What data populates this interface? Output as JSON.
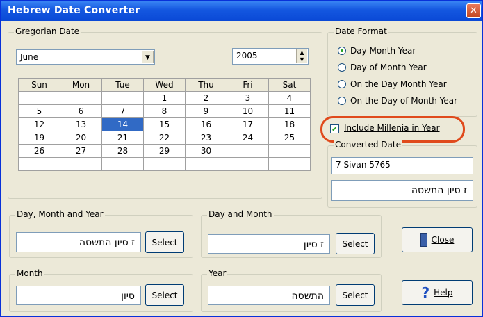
{
  "window": {
    "title": "Hebrew Date Converter",
    "close_glyph": "✕"
  },
  "gregorian": {
    "legend": "Gregorian Date",
    "month": "June",
    "year": "2005",
    "weekdays": [
      "Sun",
      "Mon",
      "Tue",
      "Wed",
      "Thu",
      "Fri",
      "Sat"
    ],
    "weeks": [
      [
        "",
        "",
        "",
        "1",
        "2",
        "3",
        "4"
      ],
      [
        "5",
        "6",
        "7",
        "8",
        "9",
        "10",
        "11"
      ],
      [
        "12",
        "13",
        "14",
        "15",
        "16",
        "17",
        "18"
      ],
      [
        "19",
        "20",
        "21",
        "22",
        "23",
        "24",
        "25"
      ],
      [
        "26",
        "27",
        "28",
        "29",
        "30",
        "",
        ""
      ],
      [
        "",
        "",
        "",
        "",
        "",
        "",
        ""
      ]
    ],
    "selected_day": "14"
  },
  "date_format": {
    "legend": "Date Format",
    "options": [
      "Day Month Year",
      "Day of Month Year",
      "On the Day Month Year",
      "On the Day of Month Year"
    ],
    "selected_index": 0
  },
  "millenia": {
    "label": "Include Millenia in Year",
    "checked": true
  },
  "converted": {
    "legend": "Converted Date",
    "english": "7 Sivan 5765",
    "hebrew": "ז סיון התשסה"
  },
  "groups": {
    "day_month_year": {
      "legend": "Day, Month and Year",
      "value": "ז סיון התשסה",
      "button": "Select"
    },
    "day_month": {
      "legend": "Day and Month",
      "value": "ז סיון",
      "button": "Select"
    },
    "month": {
      "legend": "Month",
      "value": "סיון",
      "button": "Select"
    },
    "year": {
      "legend": "Year",
      "value": "התשסה",
      "button": "Select"
    }
  },
  "buttons": {
    "close": "Close",
    "help": "Help"
  },
  "colors": {
    "title_bar": "#0a49d6",
    "selection": "#316ac5",
    "annotation": "#e04a1c"
  }
}
